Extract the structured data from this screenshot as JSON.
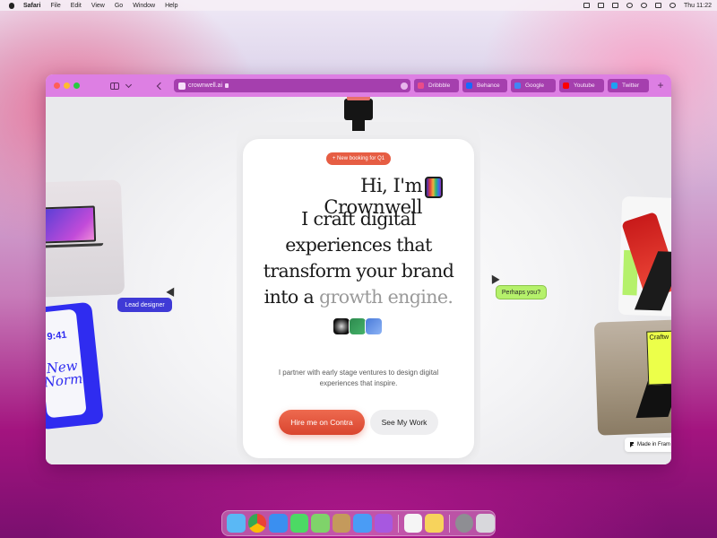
{
  "menubar": {
    "app_name": "Safari",
    "items": [
      "File",
      "Edit",
      "View",
      "Go",
      "Window",
      "Help"
    ],
    "clock": "Thu 11:22"
  },
  "browser": {
    "url": "crownwell.ai",
    "tabs": [
      {
        "label": "Dribbble",
        "color": "#ea4c89"
      },
      {
        "label": "Behance",
        "color": "#1769ff"
      },
      {
        "label": "Google",
        "color": "#4285f4"
      },
      {
        "label": "Youtube",
        "color": "#ff0000"
      },
      {
        "label": "Twitter",
        "color": "#1da1f2"
      }
    ],
    "new_tab": "+"
  },
  "hero": {
    "badge": "+ New booking for Q1",
    "greeting": "Hi, I'm Crownwell",
    "headline_main": "I craft digital experiences that transform your brand into a",
    "headline_accent": "growth engine.",
    "intro": "I partner with early stage ventures to design digital experiences that inspire.",
    "primary_cta": "Hire me on Contra",
    "secondary_cta": "See My Work"
  },
  "floating": {
    "lead_designer": "Lead designer",
    "perhaps_you": "Perhaps you?",
    "phone_time": "9:41",
    "phone_script": "New Normal",
    "scene_tag": "Craftw",
    "made_in": "Made in Fram"
  },
  "colors": {
    "accent": "#e65d43",
    "browser_toolbar": "#dd7fe3",
    "lead_pill": "#3f3ad6",
    "perhaps_pill": "#b5f16b"
  },
  "dock": {
    "apps": [
      {
        "name": "finder",
        "color": "#5ab8f5"
      },
      {
        "name": "chrome",
        "color": "#f2c230"
      },
      {
        "name": "app-store",
        "color": "#3a8ff0"
      },
      {
        "name": "messages",
        "color": "#4cd964"
      },
      {
        "name": "maps",
        "color": "#7fd36a"
      },
      {
        "name": "archive",
        "color": "#c49a5c"
      },
      {
        "name": "mail",
        "color": "#4a9cf5"
      },
      {
        "name": "podcasts",
        "color": "#a758e0"
      },
      {
        "name": "reminders",
        "color": "#f5f5f5"
      },
      {
        "name": "notes",
        "color": "#f7d35c"
      },
      {
        "name": "settings",
        "color": "#8e8e93"
      },
      {
        "name": "trash",
        "color": "#d8d8dc"
      }
    ]
  }
}
